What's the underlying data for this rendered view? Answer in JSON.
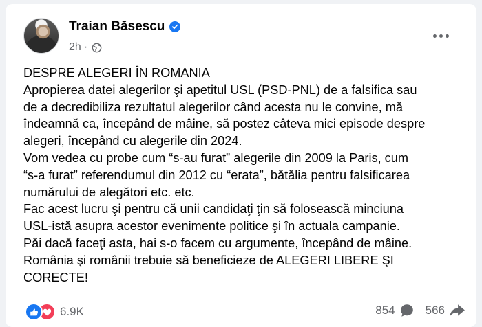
{
  "post": {
    "author": "Traian Băsescu",
    "time": "2h",
    "separator": "·",
    "lines": [
      "DESPRE ALEGERI ÎN ROMANIA",
      "Apropierea datei alegerilor şi apetitul USL (PSD-PNL) de a falsifica sau",
      "de a decredibiliza rezultatul alegerilor când acesta nu le convine,  mă",
      "îndeamnă ca, începând de mâine, să postez câteva mici episode despre",
      "alegeri, începând cu alegerile din 2024.",
      "Vom vedea cu probe cum “s-au furat” alegerile din 2009 la Paris, cum",
      "“s-a furat” referendumul din 2012 cu “erata”, bătălia pentru falsificarea",
      "numărului de alegători etc. etc.",
      "Fac acest lucru şi pentru că unii candidaţi ţin să folosească minciuna",
      "USL-istă asupra acestor evenimente politice şi în actuala campanie.",
      "Păi dacă faceţi asta, hai s-o facem cu argumente, începând de mâine.",
      "România şi românii trebuie să beneficieze de ALEGERI LIBERE ŞI",
      "CORECTE!"
    ]
  },
  "footer": {
    "reactions_count": "6.9K",
    "comments_count": "854",
    "shares_count": "566"
  },
  "icons": {
    "verified": "verified-badge-icon",
    "audience": "globe-icon",
    "more": "more-options-icon",
    "like": "like-reaction-icon",
    "love": "love-reaction-icon",
    "comment": "comment-icon",
    "share": "share-icon"
  },
  "colors": {
    "accent": "#1877f2",
    "love": "#f33e58",
    "secondary_text": "#65676b",
    "background": "#f0f2f5"
  }
}
